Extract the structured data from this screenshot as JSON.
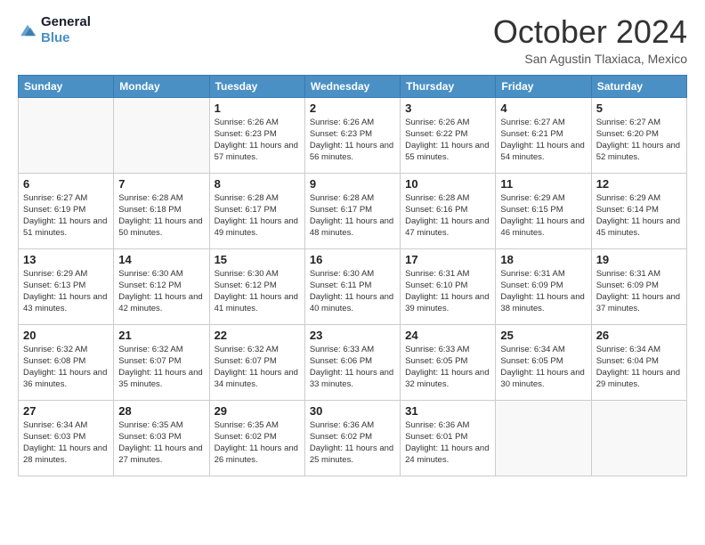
{
  "header": {
    "logo_line1": "General",
    "logo_line2": "Blue",
    "month": "October 2024",
    "location": "San Agustin Tlaxiaca, Mexico"
  },
  "weekdays": [
    "Sunday",
    "Monday",
    "Tuesday",
    "Wednesday",
    "Thursday",
    "Friday",
    "Saturday"
  ],
  "weeks": [
    [
      {
        "day": "",
        "sunrise": "",
        "sunset": "",
        "daylight": ""
      },
      {
        "day": "",
        "sunrise": "",
        "sunset": "",
        "daylight": ""
      },
      {
        "day": "1",
        "sunrise": "6:26 AM",
        "sunset": "6:23 PM",
        "daylight": "11 hours and 57 minutes."
      },
      {
        "day": "2",
        "sunrise": "6:26 AM",
        "sunset": "6:23 PM",
        "daylight": "11 hours and 56 minutes."
      },
      {
        "day": "3",
        "sunrise": "6:26 AM",
        "sunset": "6:22 PM",
        "daylight": "11 hours and 55 minutes."
      },
      {
        "day": "4",
        "sunrise": "6:27 AM",
        "sunset": "6:21 PM",
        "daylight": "11 hours and 54 minutes."
      },
      {
        "day": "5",
        "sunrise": "6:27 AM",
        "sunset": "6:20 PM",
        "daylight": "11 hours and 52 minutes."
      }
    ],
    [
      {
        "day": "6",
        "sunrise": "6:27 AM",
        "sunset": "6:19 PM",
        "daylight": "11 hours and 51 minutes."
      },
      {
        "day": "7",
        "sunrise": "6:28 AM",
        "sunset": "6:18 PM",
        "daylight": "11 hours and 50 minutes."
      },
      {
        "day": "8",
        "sunrise": "6:28 AM",
        "sunset": "6:17 PM",
        "daylight": "11 hours and 49 minutes."
      },
      {
        "day": "9",
        "sunrise": "6:28 AM",
        "sunset": "6:17 PM",
        "daylight": "11 hours and 48 minutes."
      },
      {
        "day": "10",
        "sunrise": "6:28 AM",
        "sunset": "6:16 PM",
        "daylight": "11 hours and 47 minutes."
      },
      {
        "day": "11",
        "sunrise": "6:29 AM",
        "sunset": "6:15 PM",
        "daylight": "11 hours and 46 minutes."
      },
      {
        "day": "12",
        "sunrise": "6:29 AM",
        "sunset": "6:14 PM",
        "daylight": "11 hours and 45 minutes."
      }
    ],
    [
      {
        "day": "13",
        "sunrise": "6:29 AM",
        "sunset": "6:13 PM",
        "daylight": "11 hours and 43 minutes."
      },
      {
        "day": "14",
        "sunrise": "6:30 AM",
        "sunset": "6:12 PM",
        "daylight": "11 hours and 42 minutes."
      },
      {
        "day": "15",
        "sunrise": "6:30 AM",
        "sunset": "6:12 PM",
        "daylight": "11 hours and 41 minutes."
      },
      {
        "day": "16",
        "sunrise": "6:30 AM",
        "sunset": "6:11 PM",
        "daylight": "11 hours and 40 minutes."
      },
      {
        "day": "17",
        "sunrise": "6:31 AM",
        "sunset": "6:10 PM",
        "daylight": "11 hours and 39 minutes."
      },
      {
        "day": "18",
        "sunrise": "6:31 AM",
        "sunset": "6:09 PM",
        "daylight": "11 hours and 38 minutes."
      },
      {
        "day": "19",
        "sunrise": "6:31 AM",
        "sunset": "6:09 PM",
        "daylight": "11 hours and 37 minutes."
      }
    ],
    [
      {
        "day": "20",
        "sunrise": "6:32 AM",
        "sunset": "6:08 PM",
        "daylight": "11 hours and 36 minutes."
      },
      {
        "day": "21",
        "sunrise": "6:32 AM",
        "sunset": "6:07 PM",
        "daylight": "11 hours and 35 minutes."
      },
      {
        "day": "22",
        "sunrise": "6:32 AM",
        "sunset": "6:07 PM",
        "daylight": "11 hours and 34 minutes."
      },
      {
        "day": "23",
        "sunrise": "6:33 AM",
        "sunset": "6:06 PM",
        "daylight": "11 hours and 33 minutes."
      },
      {
        "day": "24",
        "sunrise": "6:33 AM",
        "sunset": "6:05 PM",
        "daylight": "11 hours and 32 minutes."
      },
      {
        "day": "25",
        "sunrise": "6:34 AM",
        "sunset": "6:05 PM",
        "daylight": "11 hours and 30 minutes."
      },
      {
        "day": "26",
        "sunrise": "6:34 AM",
        "sunset": "6:04 PM",
        "daylight": "11 hours and 29 minutes."
      }
    ],
    [
      {
        "day": "27",
        "sunrise": "6:34 AM",
        "sunset": "6:03 PM",
        "daylight": "11 hours and 28 minutes."
      },
      {
        "day": "28",
        "sunrise": "6:35 AM",
        "sunset": "6:03 PM",
        "daylight": "11 hours and 27 minutes."
      },
      {
        "day": "29",
        "sunrise": "6:35 AM",
        "sunset": "6:02 PM",
        "daylight": "11 hours and 26 minutes."
      },
      {
        "day": "30",
        "sunrise": "6:36 AM",
        "sunset": "6:02 PM",
        "daylight": "11 hours and 25 minutes."
      },
      {
        "day": "31",
        "sunrise": "6:36 AM",
        "sunset": "6:01 PM",
        "daylight": "11 hours and 24 minutes."
      },
      {
        "day": "",
        "sunrise": "",
        "sunset": "",
        "daylight": ""
      },
      {
        "day": "",
        "sunrise": "",
        "sunset": "",
        "daylight": ""
      }
    ]
  ]
}
